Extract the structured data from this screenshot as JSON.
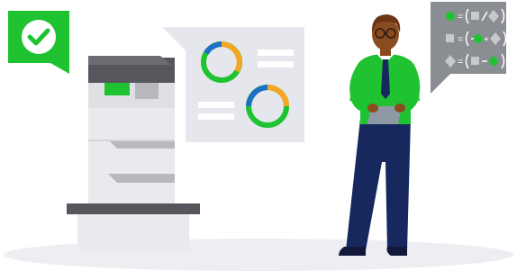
{
  "colors": {
    "green": "#1fc332",
    "blue": "#1f6fc7",
    "orange": "#f5a623",
    "panel": "#e6e7ec",
    "panel_line": "#ffffff",
    "printer_dark": "#55575c",
    "printer_light": "#e9eaee",
    "printer_mid": "#b7b9be",
    "ground": "#eceef2",
    "skin": "#8a4b1f",
    "hair": "#6b3415",
    "pants": "#16285e",
    "shoes": "#13183a",
    "tie": "#16285e",
    "tablet": "#8f98a5",
    "formula_panel": "#8a8d92"
  },
  "icons": {
    "badge": "check-icon",
    "formula_shapes": [
      "circle",
      "square",
      "diamond"
    ]
  },
  "status": {
    "badge_state": "success"
  }
}
